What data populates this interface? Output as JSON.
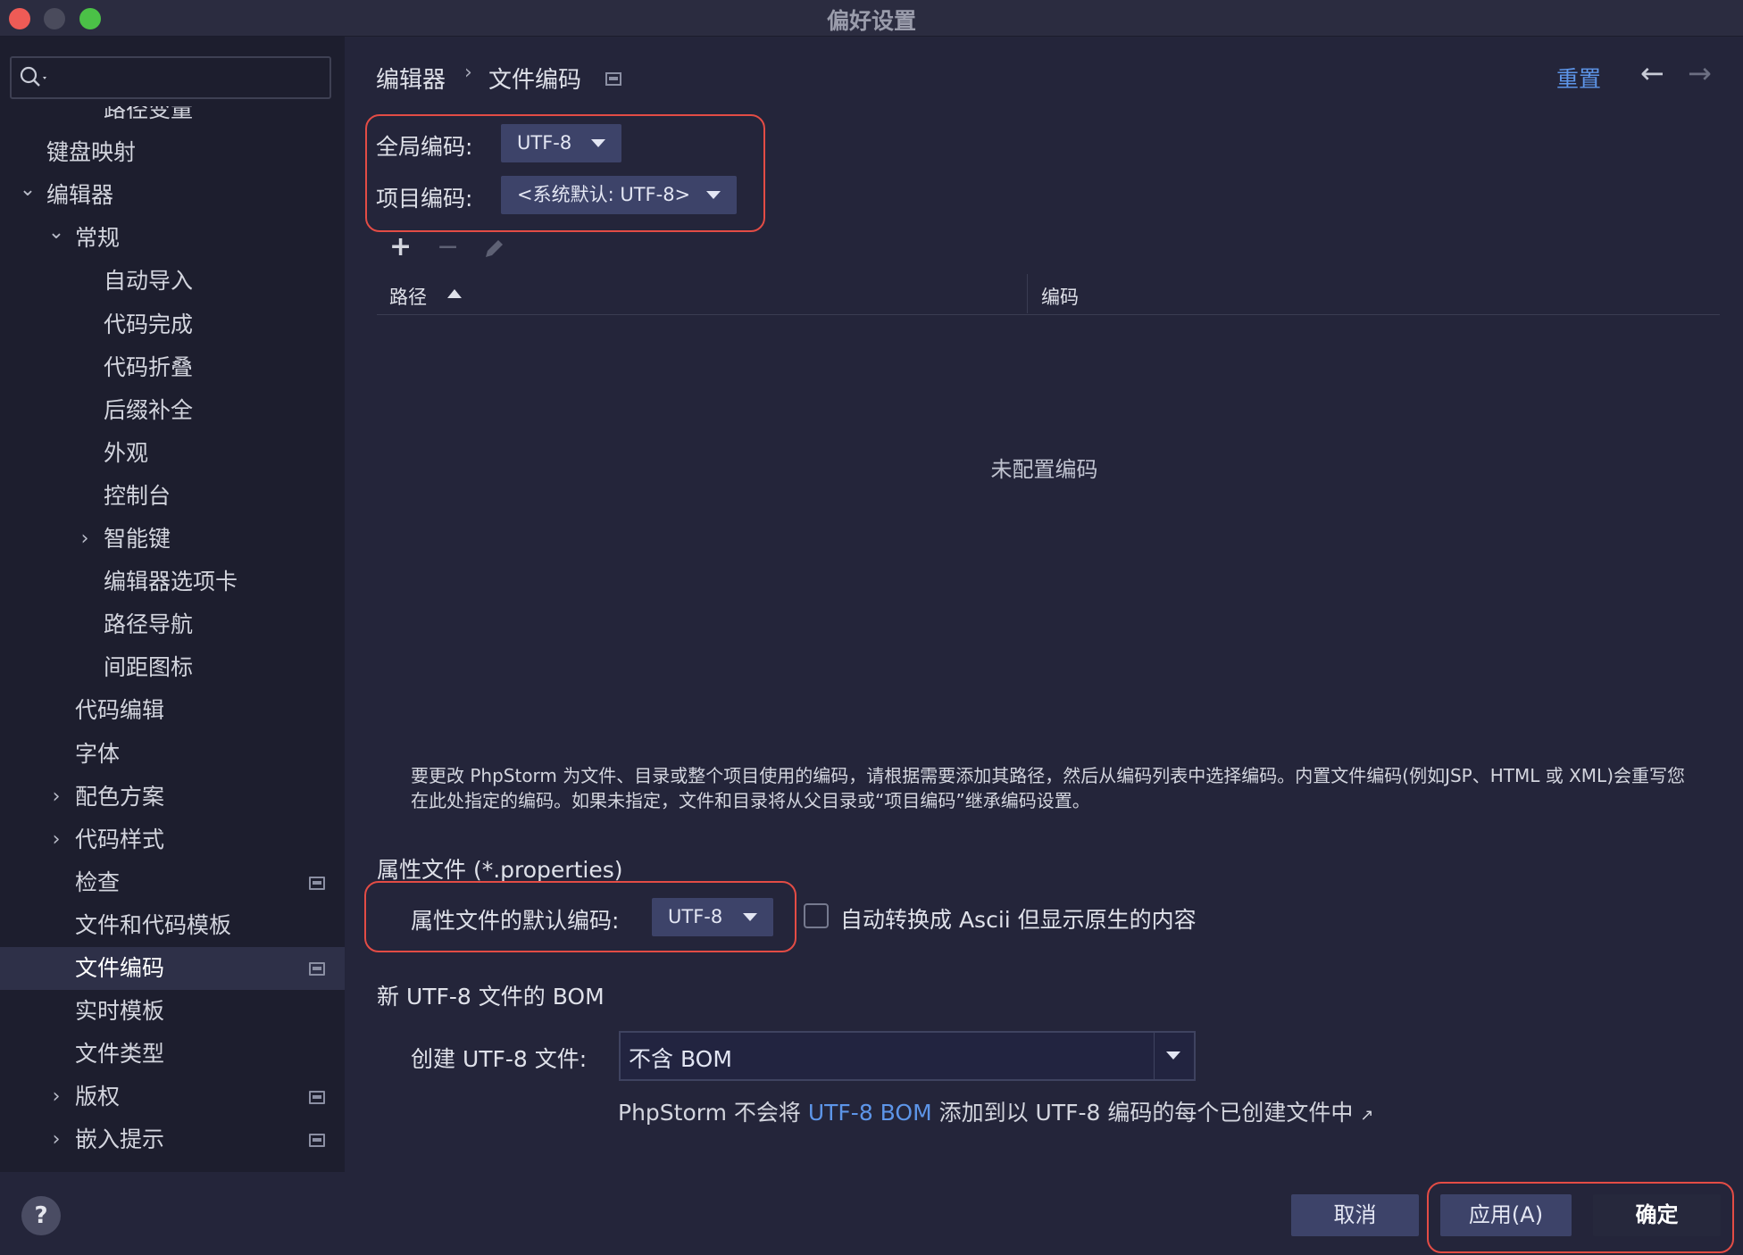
{
  "window": {
    "title": "偏好设置"
  },
  "search": {
    "value": "",
    "placeholder": ""
  },
  "sidebar": {
    "items": [
      {
        "label": "路径变量",
        "level": 2,
        "expandable": false,
        "badge": false,
        "selected": false
      },
      {
        "label": "键盘映射",
        "level": 0,
        "expandable": false,
        "badge": false,
        "selected": false
      },
      {
        "label": "编辑器",
        "level": 0,
        "expandable": true,
        "expanded": true,
        "badge": false,
        "selected": false
      },
      {
        "label": "常规",
        "level": 1,
        "expandable": true,
        "expanded": true,
        "badge": false,
        "selected": false
      },
      {
        "label": "自动导入",
        "level": 2,
        "expandable": false,
        "badge": false,
        "selected": false
      },
      {
        "label": "代码完成",
        "level": 2,
        "expandable": false,
        "badge": false,
        "selected": false
      },
      {
        "label": "代码折叠",
        "level": 2,
        "expandable": false,
        "badge": false,
        "selected": false
      },
      {
        "label": "后缀补全",
        "level": 2,
        "expandable": false,
        "badge": false,
        "selected": false
      },
      {
        "label": "外观",
        "level": 2,
        "expandable": false,
        "badge": false,
        "selected": false
      },
      {
        "label": "控制台",
        "level": 2,
        "expandable": false,
        "badge": false,
        "selected": false
      },
      {
        "label": "智能键",
        "level": 2,
        "expandable": true,
        "expanded": false,
        "badge": false,
        "selected": false
      },
      {
        "label": "编辑器选项卡",
        "level": 2,
        "expandable": false,
        "badge": false,
        "selected": false
      },
      {
        "label": "路径导航",
        "level": 2,
        "expandable": false,
        "badge": false,
        "selected": false
      },
      {
        "label": "间距图标",
        "level": 2,
        "expandable": false,
        "badge": false,
        "selected": false
      },
      {
        "label": "代码编辑",
        "level": 1,
        "expandable": false,
        "badge": false,
        "selected": false
      },
      {
        "label": "字体",
        "level": 1,
        "expandable": false,
        "badge": false,
        "selected": false
      },
      {
        "label": "配色方案",
        "level": 1,
        "expandable": true,
        "expanded": false,
        "badge": false,
        "selected": false
      },
      {
        "label": "代码样式",
        "level": 1,
        "expandable": true,
        "expanded": false,
        "badge": false,
        "selected": false
      },
      {
        "label": "检查",
        "level": 1,
        "expandable": false,
        "badge": true,
        "selected": false
      },
      {
        "label": "文件和代码模板",
        "level": 1,
        "expandable": false,
        "badge": false,
        "selected": false
      },
      {
        "label": "文件编码",
        "level": 1,
        "expandable": false,
        "badge": true,
        "selected": true
      },
      {
        "label": "实时模板",
        "level": 1,
        "expandable": false,
        "badge": false,
        "selected": false
      },
      {
        "label": "文件类型",
        "level": 1,
        "expandable": false,
        "badge": false,
        "selected": false
      },
      {
        "label": "版权",
        "level": 1,
        "expandable": true,
        "expanded": false,
        "badge": true,
        "selected": false
      },
      {
        "label": "嵌入提示",
        "level": 1,
        "expandable": true,
        "expanded": false,
        "badge": true,
        "selected": false
      }
    ]
  },
  "breadcrumb": {
    "parent": "编辑器",
    "separator": "›",
    "current": "文件编码"
  },
  "header": {
    "reset_label": "重置",
    "back_icon": "←",
    "forward_icon": "→"
  },
  "encoding": {
    "global_label": "全局编码:",
    "global_value": "UTF-8",
    "project_label": "项目编码:",
    "project_value": "<系统默认: UTF-8>"
  },
  "toolbar": {
    "add_icon": "+",
    "remove_icon": "−",
    "edit_icon": "pencil-icon"
  },
  "table": {
    "columns": [
      "路径",
      "编码"
    ],
    "empty_text": "未配置编码"
  },
  "help_text": "要更改 PhpStorm 为文件、目录或整个项目使用的编码，请根据需要添加其路径，然后从编码列表中选择编码。内置文件编码(例如JSP、HTML 或 XML)会重写您在此处指定的编码。如果未指定，文件和目录将从父目录或“项目编码”继承编码设置。",
  "properties": {
    "section_title": "属性文件 (*.properties)",
    "default_label": "属性文件的默认编码:",
    "default_value": "UTF-8",
    "ascii_checkbox_label": "自动转换成 Ascii 但显示原生的内容",
    "ascii_checked": false
  },
  "bom": {
    "section_title": "新 UTF-8 文件的 BOM",
    "create_label": "创建 UTF-8 文件:",
    "create_value": "不含 BOM",
    "note_prefix": "PhpStorm 不会将",
    "note_link": "UTF-8 BOM",
    "note_suffix": "添加到以 UTF-8 编码的每个已创建文件中",
    "note_arrow": "↗"
  },
  "footer": {
    "help_label": "?",
    "cancel_label": "取消",
    "apply_label": "应用(A)",
    "ok_label": "确定"
  },
  "colors": {
    "background": "#24253a",
    "sidebar": "#1d1e2e",
    "accent_link": "#5d95e8",
    "highlight_box": "#e34c45",
    "dropdown": "#3d4369"
  }
}
